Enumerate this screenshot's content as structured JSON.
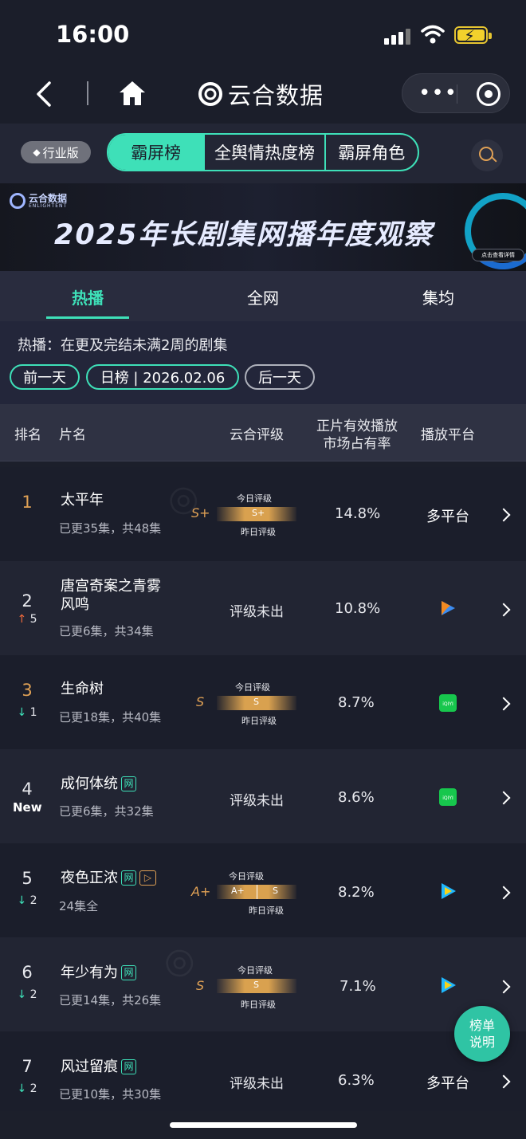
{
  "status_bar": {
    "time": "16:00"
  },
  "nav": {
    "brand": "云合数据"
  },
  "toolbar": {
    "edition": "行业版",
    "segments": [
      "霸屏榜",
      "全舆情热度榜",
      "霸屏角色"
    ]
  },
  "banner": {
    "logo_text": "云合数据",
    "logo_sub": "ENLIGHTENT",
    "title": "2025年长剧集网播年度观察",
    "cta": "点击查看详情"
  },
  "tabs": [
    "热播",
    "全网",
    "集均"
  ],
  "filter": {
    "description": "热播：在更及完结未满2周的剧集",
    "prev": "前一天",
    "current": "日榜 | 2026.02.06",
    "next": "后一天"
  },
  "table": {
    "headers": {
      "rank": "排名",
      "title": "片名",
      "rating": "云合评级",
      "share_line1": "正片有效播放",
      "share_line2": "市场占有率",
      "platform": "播放平台"
    },
    "rating_labels": {
      "today": "今日评级",
      "yesterday": "昨日评级"
    },
    "rows": [
      {
        "rank": "1",
        "trend": "",
        "title": "太平年",
        "badge": "",
        "sub": "已更35集，共48集",
        "rating": "S+",
        "today": "S+",
        "yesterday": "",
        "share": "14.8%",
        "platform": "多平台"
      },
      {
        "rank": "2",
        "trend": "↑5",
        "title_l1": "唐宫奇案之青雾",
        "title_l2": "风鸣",
        "sub": "已更6集，共34集",
        "rating": "评级未出",
        "share": "10.8%",
        "platform_icon": "tencent-video-icon"
      },
      {
        "rank": "3",
        "trend": "↓1",
        "title": "生命树",
        "sub": "已更18集，共40集",
        "rating": "S",
        "today": "S",
        "share": "8.7%",
        "platform_icon": "iqiyi-icon"
      },
      {
        "rank": "4",
        "trend": "New",
        "title": "成何体统",
        "badge": "网",
        "sub": "已更6集，共32集",
        "rating": "评级未出",
        "share": "8.6%",
        "platform_icon": "iqiyi-icon"
      },
      {
        "rank": "5",
        "trend": "↓2",
        "title": "夜色正浓",
        "badge": "网",
        "sub": "24集全",
        "rating": "A+",
        "today": "A+",
        "yesterday": "S",
        "share": "8.2%",
        "platform_icon": "youku-icon"
      },
      {
        "rank": "6",
        "trend": "↓2",
        "title": "年少有为",
        "badge": "网",
        "sub": "已更14集，共26集",
        "rating": "S",
        "today": "S",
        "share": "7.1%",
        "platform_icon": "youku-icon"
      },
      {
        "rank": "7",
        "trend": "↓2",
        "title": "风过留痕",
        "badge": "网",
        "sub": "已更10集，共30集",
        "rating": "评级未出",
        "share": "6.3%",
        "platform": "多平台"
      }
    ]
  },
  "fab": {
    "line1": "榜单",
    "line2": "说明"
  },
  "colors": {
    "accent": "#3ee0b8",
    "gold": "#e0a155",
    "background": "#1c1f2b"
  }
}
